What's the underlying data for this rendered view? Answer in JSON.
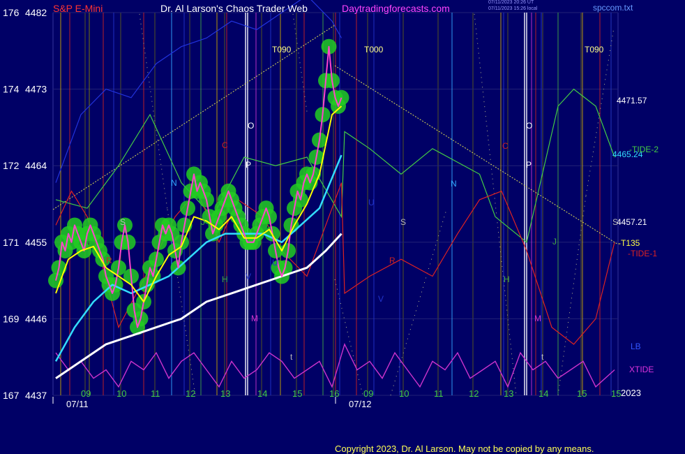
{
  "header": {
    "instrument": "S&P E-Mini",
    "author": "Dr. Al Larson's Chaos Trader Web",
    "site": "Daytradingforecasts.com",
    "stamp_line1": "07/11/2023 20:26 UT",
    "stamp_line2": "07/11/2023 15:26 local",
    "file": "spccom.txt"
  },
  "copyright": "Copyright 2023, Dr. Al Larson. May not be copied by any means.",
  "colors": {
    "background": "#000066",
    "price_halo": "#22cc22",
    "price_line": "#ff44cc",
    "fast_ma": "#ffff00",
    "mid_ma": "#33ddff",
    "slow_ma": "#ffffff",
    "tide1": "#dd2222",
    "tide2": "#44cc44",
    "xtide": "#cc33cc",
    "lb": "#2233dd",
    "trend": "#dddd55"
  },
  "chart_data": {
    "type": "line",
    "y_axis": {
      "left_labels": [
        {
          "v": 176,
          "p": 4482
        },
        {
          "v": 174,
          "p": 4473
        },
        {
          "v": 172,
          "p": 4464
        },
        {
          "v": 171,
          "p": 4455
        },
        {
          "v": 169,
          "p": 4446
        },
        {
          "v": 167,
          "p": 4437
        }
      ],
      "ylim": [
        4437,
        4482
      ]
    },
    "x_axis": {
      "hours": [
        "09",
        "10",
        "11",
        "12",
        "13",
        "14",
        "15",
        "16",
        "09",
        "10",
        "11",
        "12",
        "13",
        "14",
        "15",
        "15"
      ],
      "dates": [
        "07/11",
        "07/12"
      ],
      "year": "2023"
    },
    "right_labels": [
      {
        "text": "4471.57",
        "price": 4471.57
      },
      {
        "text": "4465.24",
        "price": 4465.24
      },
      {
        "text": "4457.21",
        "price": 4457.21
      },
      {
        "text": "-T135",
        "price": 4455
      }
    ],
    "series_labels": {
      "tide2": "-TIDE-2",
      "tide1": "-TIDE-1",
      "lb": "LB",
      "xtide": "XTIDE"
    },
    "timing_labels": [
      "T090",
      "T000",
      "T090"
    ],
    "planet_letters": [
      "O",
      "P",
      "C",
      "N",
      "S",
      "R",
      "J",
      "H",
      "M",
      "V",
      "U",
      "t",
      "O",
      "P",
      "C",
      "N",
      "S",
      "R",
      "J",
      "H",
      "M",
      "V",
      "U",
      "t",
      "S"
    ],
    "price": [
      [
        0,
        4450.5
      ],
      [
        1,
        4452
      ],
      [
        2,
        4455
      ],
      [
        3,
        4454
      ],
      [
        4,
        4456
      ],
      [
        5,
        4455
      ],
      [
        6,
        4457
      ],
      [
        7,
        4456
      ],
      [
        8,
        4455
      ],
      [
        9,
        4454
      ],
      [
        10,
        4456
      ],
      [
        11,
        4457
      ],
      [
        12,
        4456
      ],
      [
        13,
        4455
      ],
      [
        14,
        4454
      ],
      [
        15,
        4453
      ],
      [
        16,
        4451
      ],
      [
        17,
        4450
      ],
      [
        18,
        4449
      ],
      [
        19,
        4450
      ],
      [
        20,
        4452
      ],
      [
        21,
        4455
      ],
      [
        22,
        4457
      ],
      [
        23,
        4455
      ],
      [
        24,
        4451
      ],
      [
        25,
        4447
      ],
      [
        26,
        4445
      ],
      [
        27,
        4446
      ],
      [
        28,
        4448
      ],
      [
        29,
        4450
      ],
      [
        30,
        4452
      ],
      [
        31,
        4451
      ],
      [
        32,
        4453
      ],
      [
        33,
        4455
      ],
      [
        34,
        4457
      ],
      [
        35,
        4456
      ],
      [
        36,
        4457
      ],
      [
        37,
        4456
      ],
      [
        38,
        4454
      ],
      [
        39,
        4452
      ],
      [
        40,
        4455
      ],
      [
        41,
        4457
      ],
      [
        42,
        4459
      ],
      [
        43,
        4461
      ],
      [
        44,
        4463
      ],
      [
        45,
        4461
      ],
      [
        46,
        4462
      ],
      [
        47,
        4461
      ],
      [
        48,
        4460
      ],
      [
        49,
        4458
      ],
      [
        50,
        4456
      ],
      [
        51,
        4457
      ],
      [
        52,
        4458
      ],
      [
        53,
        4459
      ],
      [
        54,
        4460
      ],
      [
        55,
        4461
      ],
      [
        56,
        4460
      ],
      [
        57,
        4459
      ],
      [
        58,
        4458
      ],
      [
        59,
        4457
      ],
      [
        60,
        4456
      ],
      [
        61,
        4455
      ],
      [
        62,
        4455
      ],
      [
        63,
        4455
      ],
      [
        64,
        4456
      ],
      [
        65,
        4457
      ],
      [
        66,
        4458
      ],
      [
        67,
        4459
      ],
      [
        68,
        4458
      ],
      [
        69,
        4456
      ],
      [
        70,
        4454
      ],
      [
        71,
        4452
      ],
      [
        72,
        4451
      ],
      [
        73,
        4452
      ],
      [
        74,
        4454
      ],
      [
        75,
        4457
      ],
      [
        76,
        4459
      ],
      [
        77,
        4461
      ],
      [
        78,
        4460
      ],
      [
        79,
        4462
      ],
      [
        80,
        4463
      ],
      [
        81,
        4462
      ],
      [
        82,
        4463
      ],
      [
        83,
        4465
      ],
      [
        84,
        4467
      ],
      [
        85,
        4470
      ],
      [
        86,
        4474
      ],
      [
        87,
        4478
      ],
      [
        88,
        4474
      ],
      [
        89,
        4472
      ],
      [
        90,
        4471
      ],
      [
        91,
        4472
      ]
    ],
    "fast_ma": [
      [
        0,
        4449
      ],
      [
        4,
        4453
      ],
      [
        8,
        4454
      ],
      [
        12,
        4454.5
      ],
      [
        16,
        4452
      ],
      [
        20,
        4451
      ],
      [
        24,
        4450
      ],
      [
        28,
        4448
      ],
      [
        32,
        4451
      ],
      [
        36,
        4453.5
      ],
      [
        40,
        4454.5
      ],
      [
        44,
        4458
      ],
      [
        48,
        4457.5
      ],
      [
        52,
        4456.5
      ],
      [
        56,
        4458
      ],
      [
        60,
        4455.5
      ],
      [
        64,
        4455.5
      ],
      [
        68,
        4456.5
      ],
      [
        72,
        4454
      ],
      [
        76,
        4457
      ],
      [
        80,
        4459.5
      ],
      [
        84,
        4463
      ],
      [
        88,
        4470
      ],
      [
        91,
        4471
      ]
    ],
    "mid_ma": [
      [
        0,
        4441
      ],
      [
        6,
        4445
      ],
      [
        12,
        4448
      ],
      [
        18,
        4450
      ],
      [
        24,
        4449
      ],
      [
        30,
        4450
      ],
      [
        36,
        4451
      ],
      [
        42,
        4453
      ],
      [
        48,
        4455
      ],
      [
        54,
        4456
      ],
      [
        60,
        4456
      ],
      [
        66,
        4456
      ],
      [
        72,
        4455
      ],
      [
        78,
        4457
      ],
      [
        84,
        4459
      ],
      [
        91,
        4465.24
      ]
    ],
    "slow_ma": [
      [
        0,
        4439
      ],
      [
        8,
        4441
      ],
      [
        16,
        4443
      ],
      [
        24,
        4444
      ],
      [
        32,
        4445
      ],
      [
        40,
        4446
      ],
      [
        48,
        4448
      ],
      [
        56,
        4449
      ],
      [
        64,
        4450
      ],
      [
        72,
        4451
      ],
      [
        80,
        4452
      ],
      [
        86,
        4454
      ],
      [
        91,
        4456
      ]
    ],
    "lb": [
      [
        0,
        4462
      ],
      [
        8,
        4470
      ],
      [
        16,
        4473
      ],
      [
        24,
        4472
      ],
      [
        32,
        4476
      ],
      [
        40,
        4478
      ],
      [
        48,
        4479
      ],
      [
        56,
        4481
      ],
      [
        64,
        4480
      ],
      [
        72,
        4482
      ],
      [
        80,
        4484
      ],
      [
        88,
        4481
      ],
      [
        91,
        4479
      ]
    ],
    "tide2": [
      [
        0,
        4460
      ],
      [
        10,
        4459
      ],
      [
        20,
        4464
      ],
      [
        30,
        4470
      ],
      [
        40,
        4462
      ],
      [
        50,
        4458
      ],
      [
        60,
        4465
      ],
      [
        70,
        4464
      ],
      [
        80,
        4465
      ],
      [
        91,
        4458
      ],
      [
        92,
        4468
      ],
      [
        100,
        4466
      ],
      [
        110,
        4463
      ],
      [
        120,
        4466
      ],
      [
        135,
        4463
      ],
      [
        140,
        4458
      ],
      [
        150,
        4455
      ],
      [
        160,
        4471
      ],
      [
        165,
        4473
      ],
      [
        172,
        4471
      ],
      [
        178,
        4465
      ]
    ],
    "tide1": [
      [
        0,
        4457
      ],
      [
        5,
        4461
      ],
      [
        10,
        4458
      ],
      [
        15,
        4452
      ],
      [
        20,
        4445
      ],
      [
        30,
        4452
      ],
      [
        38,
        4458
      ],
      [
        45,
        4461
      ],
      [
        52,
        4455
      ],
      [
        58,
        4460
      ],
      [
        66,
        4458
      ],
      [
        72,
        4454
      ],
      [
        80,
        4451
      ],
      [
        91,
        4462
      ],
      [
        92,
        4449
      ],
      [
        100,
        4451
      ],
      [
        110,
        4453
      ],
      [
        120,
        4451
      ],
      [
        128,
        4456
      ],
      [
        135,
        4460
      ],
      [
        142,
        4461
      ],
      [
        150,
        4454
      ],
      [
        158,
        4445
      ],
      [
        165,
        4443
      ],
      [
        172,
        4446
      ],
      [
        178,
        4455
      ]
    ],
    "xtide": [
      [
        0,
        4442
      ],
      [
        4,
        4440
      ],
      [
        8,
        4441
      ],
      [
        12,
        4439
      ],
      [
        16,
        4440
      ],
      [
        20,
        4438
      ],
      [
        24,
        4441
      ],
      [
        28,
        4440
      ],
      [
        32,
        4442
      ],
      [
        36,
        4439
      ],
      [
        40,
        4441
      ],
      [
        44,
        4442
      ],
      [
        48,
        4440
      ],
      [
        52,
        4438
      ],
      [
        56,
        4441
      ],
      [
        60,
        4439
      ],
      [
        64,
        4440
      ],
      [
        68,
        4442
      ],
      [
        72,
        4441
      ],
      [
        76,
        4439
      ],
      [
        80,
        4440
      ],
      [
        84,
        4441
      ],
      [
        88,
        4438
      ],
      [
        92,
        4443
      ],
      [
        96,
        4440
      ],
      [
        100,
        4441
      ],
      [
        104,
        4439
      ],
      [
        108,
        4442
      ],
      [
        112,
        4440
      ],
      [
        116,
        4438
      ],
      [
        120,
        4441
      ],
      [
        124,
        4440
      ],
      [
        128,
        4442
      ],
      [
        132,
        4439
      ],
      [
        136,
        4440
      ],
      [
        140,
        4441
      ],
      [
        144,
        4438
      ],
      [
        148,
        4442
      ],
      [
        152,
        4440
      ],
      [
        156,
        4441
      ],
      [
        160,
        4439
      ],
      [
        164,
        4440
      ],
      [
        168,
        4441
      ],
      [
        172,
        4438
      ],
      [
        178,
        4440
      ]
    ]
  }
}
